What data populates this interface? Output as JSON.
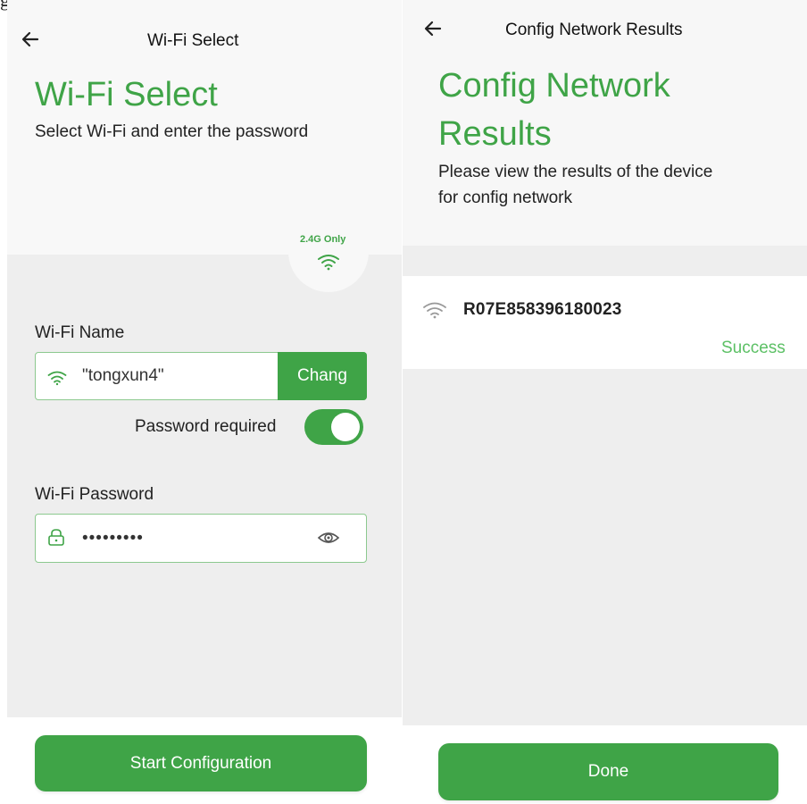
{
  "top_crop_glyph": "g",
  "wifi_select": {
    "header_title": "Wi-Fi Select",
    "title": "Wi-Fi Select",
    "subtitle": "Select Wi-Fi and enter the password",
    "badge_text": "2.4G Only",
    "wifi_name_label": "Wi-Fi Name",
    "wifi_name_value": "\"tongxun4\"",
    "change_label": "Chang",
    "password_required_label": "Password required",
    "password_required_on": true,
    "wifi_password_label": "Wi-Fi Password",
    "wifi_password_value": "•••••••••",
    "start_button": "Start Configuration"
  },
  "config_results": {
    "header_title": "Config Network Results",
    "title_line1": "Config Network",
    "title_line2": "Results",
    "subtitle_line1": "Please view the results of the device",
    "subtitle_line2": "for config network",
    "results": [
      {
        "device_id": "R07E858396180023",
        "status": "Success"
      }
    ],
    "done_button": "Done"
  },
  "colors": {
    "accent": "#3fa447",
    "success_text": "#5cc065",
    "input_border": "#8cc98f",
    "panel_gray": "#eeeeee"
  },
  "icons": [
    "back-arrow-icon",
    "wifi-icon",
    "lock-icon",
    "eye-icon"
  ]
}
